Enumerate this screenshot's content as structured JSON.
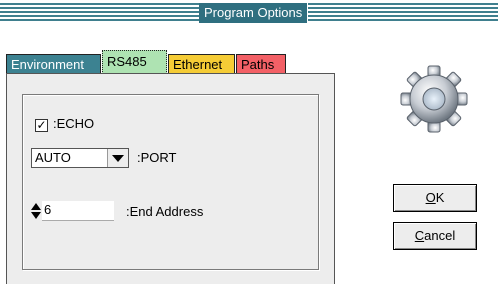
{
  "window": {
    "title": "Program Options"
  },
  "tabs": [
    {
      "label": "Environment",
      "color": "#3c8291"
    },
    {
      "label": "RS485",
      "color": "#aee3b2",
      "active": true
    },
    {
      "label": "Ethernet",
      "color": "#f5cc36"
    },
    {
      "label": "Paths",
      "color": "#f36066"
    }
  ],
  "rs485": {
    "echo": {
      "checked": true,
      "check_mark": "✓",
      "label": ":ECHO"
    },
    "port": {
      "selected": "AUTO",
      "label": ":PORT"
    },
    "end_address": {
      "value": "6",
      "label": ":End Address"
    }
  },
  "buttons": {
    "ok_accel": "O",
    "ok_rest": "K",
    "cancel_accel": "C",
    "cancel_rest": "ancel"
  },
  "icons": {
    "settings": "gear-icon"
  }
}
